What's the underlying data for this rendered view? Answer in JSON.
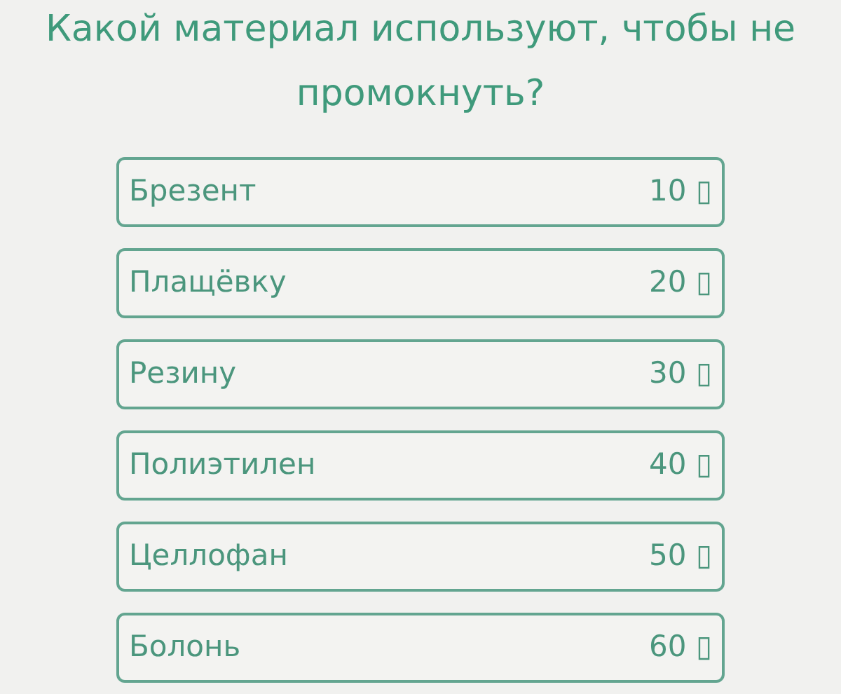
{
  "question": "Какой материал используют, чтобы не промокнуть?",
  "answers": [
    {
      "label": "Брезент",
      "points": "10 ▯"
    },
    {
      "label": "Плащёвку",
      "points": "20 ▯"
    },
    {
      "label": "Резину",
      "points": "30 ▯"
    },
    {
      "label": "Полиэтилен",
      "points": "40 ▯"
    },
    {
      "label": "Целлофан",
      "points": "50 ▯"
    },
    {
      "label": "Болонь",
      "points": "60 ▯"
    }
  ]
}
